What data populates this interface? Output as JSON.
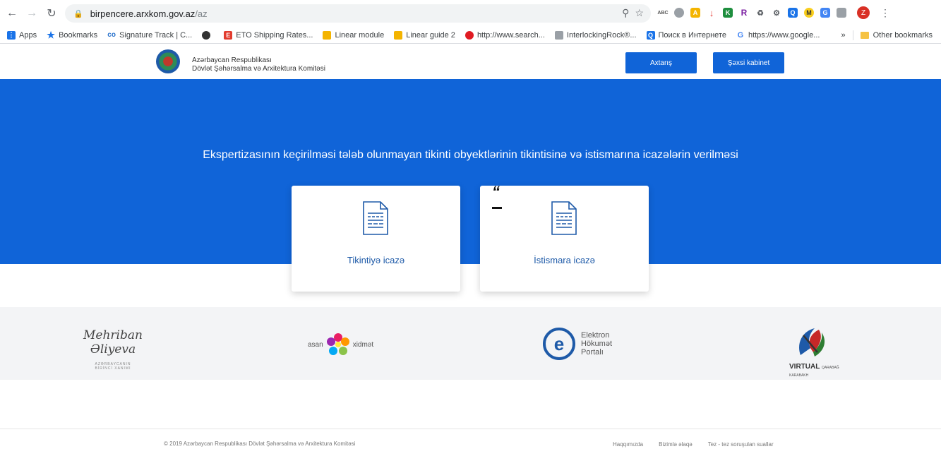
{
  "browser": {
    "url_host": "birpencere.arxkom.gov.az",
    "url_path": "/az",
    "extensions": [
      "abc-icon",
      "circle-icon",
      "chart-icon",
      "download-icon",
      "k-icon",
      "r-icon",
      "puzzle-icon",
      "plugin-icon",
      "q-icon",
      "m-icon",
      "translate-icon",
      "cast-icon"
    ],
    "avatar_letter": "Z",
    "bookmarks": [
      {
        "label": "Apps",
        "icon": "apps-grid-icon",
        "color": "#1a73e8"
      },
      {
        "label": "Bookmarks",
        "icon": "star-icon",
        "color": "#1a73e8"
      },
      {
        "label": "Signature Track | C...",
        "icon": "coursera-icon",
        "color": "#2a73cc"
      },
      {
        "label": "",
        "icon": "globe-icon",
        "color": "#333333"
      },
      {
        "label": "ETO Shipping Rates...",
        "icon": "eto-icon",
        "color": "#e23b2e"
      },
      {
        "label": "Linear module",
        "icon": "linear-icon",
        "color": "#f4b400"
      },
      {
        "label": "Linear guide 2",
        "icon": "linear-icon",
        "color": "#f4b400"
      },
      {
        "label": "http://www.search...",
        "icon": "opera-icon",
        "color": "#e01b22"
      },
      {
        "label": "InterlockingRock®...",
        "icon": "page-icon",
        "color": "#9aa0a6"
      },
      {
        "label": "Поиск в Интернете",
        "icon": "search-q-icon",
        "color": "#1a73e8"
      },
      {
        "label": "https://www.google...",
        "icon": "google-icon",
        "color": "#4285f4"
      }
    ],
    "more_chevron": "»",
    "other_bookmarks": "Other bookmarks"
  },
  "header": {
    "org_line1": "Azərbaycan Respublikası",
    "org_line2": "Dövlət Şəhərsalma və Arxitektura Komitəsi",
    "search_button": "Axtarış",
    "cabinet_button": "Şəxsi kabinet"
  },
  "hero": {
    "title": "Ekspertizasının keçirilməsi tələb olunmayan tikinti obyektlərinin tikintisinə və istismarına icazələrin verilməsi",
    "stray_quote": "“",
    "cards": [
      {
        "label": "Tikintiyə icazə",
        "icon": "document-icon"
      },
      {
        "label": "İstismara icazə",
        "icon": "document-icon"
      }
    ]
  },
  "partners": {
    "mehriban_signature": "Mehriban Əliyeva",
    "mehriban_sub1": "AZƏRBAYCANIN",
    "mehriban_sub2": "BİRİNCİ XANIMI",
    "asan_left": "asan",
    "asan_right": "xidmət",
    "egov_line1": "Elektron",
    "egov_line2": "Hökumət",
    "egov_line3": "Portalı",
    "virtual_main": "VIRTUAL",
    "virtual_small1": "QARABAĞ",
    "virtual_small2": "KARABAKH"
  },
  "footer": {
    "copyright": "© 2019 Azərbaycan Respublikası Dövlət Şəhərsalma və Arxitektura Komitəsi",
    "links": [
      "Haqqımızda",
      "Bizimlə əlaqə",
      "Tez - tez soruşulan suallar"
    ]
  }
}
